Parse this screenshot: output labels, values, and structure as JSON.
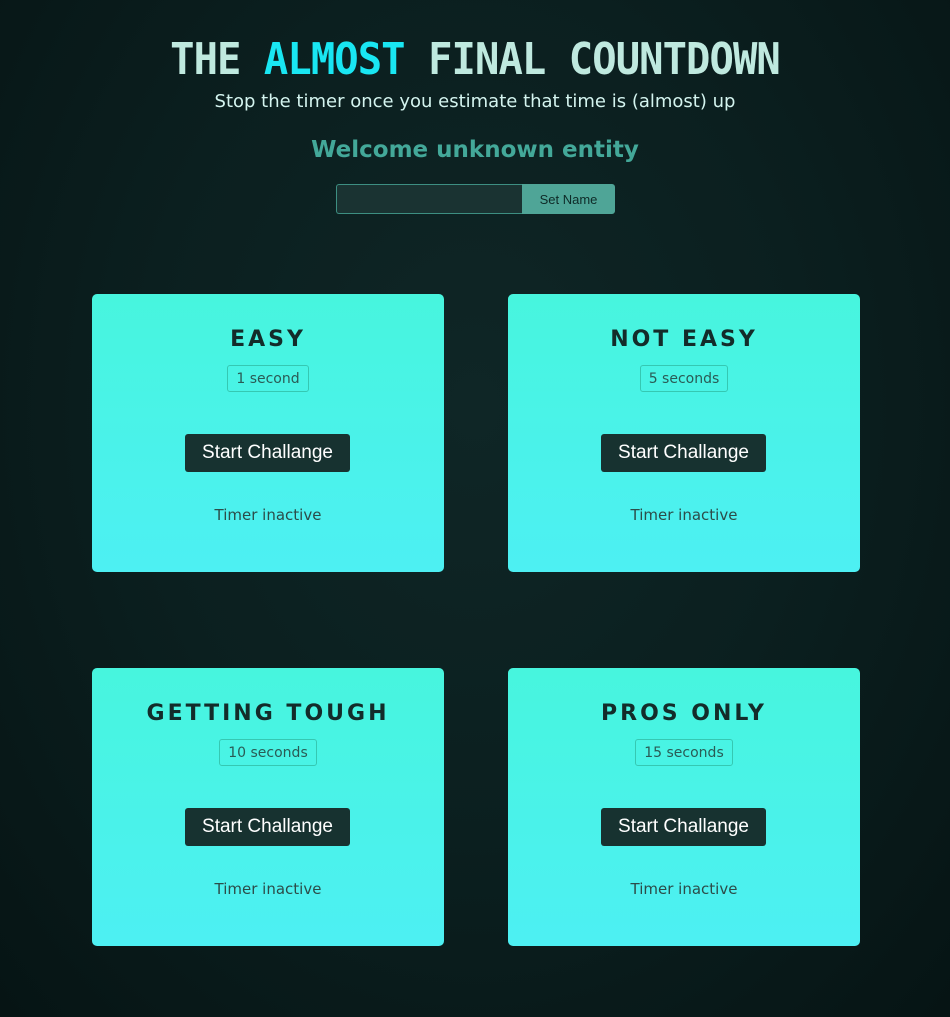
{
  "header": {
    "title_part1": "THE ",
    "title_accent": "ALMOST",
    "title_part2": " FINAL COUNTDOWN",
    "subtitle": "Stop the timer once you estimate that time is (almost) up",
    "welcome": "Welcome unknown entity"
  },
  "name_form": {
    "input_value": "",
    "input_placeholder": "",
    "button_label": "Set Name"
  },
  "challenges": [
    {
      "title": "EASY",
      "duration": "1 second",
      "button_label": "Start Challange",
      "status": "Timer inactive"
    },
    {
      "title": "NOT EASY",
      "duration": "5 seconds",
      "button_label": "Start Challange",
      "status": "Timer inactive"
    },
    {
      "title": "GETTING TOUGH",
      "duration": "10 seconds",
      "button_label": "Start Challange",
      "status": "Timer inactive"
    },
    {
      "title": "PROS ONLY",
      "duration": "15 seconds",
      "button_label": "Start Challange",
      "status": "Timer inactive"
    }
  ],
  "colors": {
    "background": "#0b1f1f",
    "title_text": "#bfe9df",
    "title_accent": "#19e6f2",
    "welcome_text": "#43a899",
    "card_gradient_top": "#47f5de",
    "card_gradient_bottom": "#4df0f3",
    "card_button": "#173230",
    "set_name_button": "#4fa597"
  }
}
